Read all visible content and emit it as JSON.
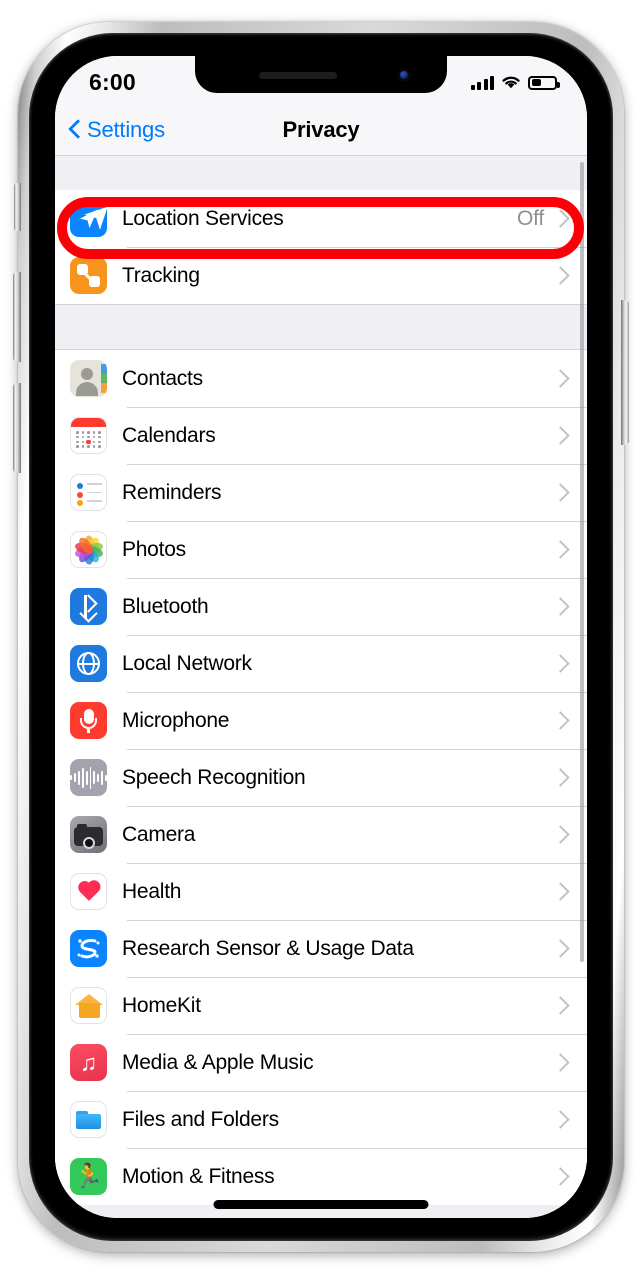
{
  "status_bar": {
    "time": "6:00",
    "signal_icon": "cellular-bars-icon",
    "wifi_icon": "wifi-icon",
    "battery_icon": "battery-icon",
    "battery_level_percent": 42
  },
  "nav": {
    "back_label": "Settings",
    "title": "Privacy",
    "back_icon": "chevron-left-icon",
    "accent_color": "#007aff"
  },
  "annotation": {
    "type": "oval-highlight",
    "color": "#fb0007",
    "targets_row": "Location Services"
  },
  "groups": [
    {
      "rows": [
        {
          "label": "Location Services",
          "value": "Off",
          "icon": "location-arrow-icon",
          "icon_color": "#0a84ff",
          "highlighted": true
        },
        {
          "label": "Tracking",
          "value": "",
          "icon": "tracking-nodes-icon",
          "icon_color": "#f7941e",
          "highlighted": false
        }
      ]
    },
    {
      "rows": [
        {
          "label": "Contacts",
          "value": "",
          "icon": "contacts-icon",
          "icon_color": "#e5e3da",
          "highlighted": false
        },
        {
          "label": "Calendars",
          "value": "",
          "icon": "calendar-icon",
          "icon_color": "#ff3b30",
          "highlighted": false
        },
        {
          "label": "Reminders",
          "value": "",
          "icon": "reminders-icon",
          "icon_color": "#ffffff",
          "highlighted": false
        },
        {
          "label": "Photos",
          "value": "",
          "icon": "photos-icon",
          "icon_color": "#ffffff",
          "highlighted": false
        },
        {
          "label": "Bluetooth",
          "value": "",
          "icon": "bluetooth-icon",
          "icon_color": "#1f7ae0",
          "highlighted": false
        },
        {
          "label": "Local Network",
          "value": "",
          "icon": "globe-icon",
          "icon_color": "#1f7ae0",
          "highlighted": false
        },
        {
          "label": "Microphone",
          "value": "",
          "icon": "microphone-icon",
          "icon_color": "#ff3b30",
          "highlighted": false
        },
        {
          "label": "Speech Recognition",
          "value": "",
          "icon": "waveform-icon",
          "icon_color": "#a3a3ad",
          "highlighted": false
        },
        {
          "label": "Camera",
          "value": "",
          "icon": "camera-icon",
          "icon_color": "#6f6f76",
          "highlighted": false
        },
        {
          "label": "Health",
          "value": "",
          "icon": "heart-icon",
          "icon_color": "#ff2d55",
          "highlighted": false
        },
        {
          "label": "Research Sensor & Usage Data",
          "value": "",
          "icon": "research-sensor-icon",
          "icon_color": "#0a84ff",
          "highlighted": false
        },
        {
          "label": "HomeKit",
          "value": "",
          "icon": "house-icon",
          "icon_color": "#f5a623",
          "highlighted": false
        },
        {
          "label": "Media & Apple Music",
          "value": "",
          "icon": "music-note-icon",
          "icon_color": "#e8334f",
          "highlighted": false
        },
        {
          "label": "Files and Folders",
          "value": "",
          "icon": "folder-icon",
          "icon_color": "#2aa3f0",
          "highlighted": false
        },
        {
          "label": "Motion & Fitness",
          "value": "",
          "icon": "running-person-icon",
          "icon_color": "#34c759",
          "highlighted": false
        }
      ]
    }
  ],
  "device": {
    "frame": "iphone-silver",
    "notch_speaker": "earpiece-speaker",
    "notch_camera": "front-camera",
    "home_indicator": "home-indicator-bar"
  }
}
